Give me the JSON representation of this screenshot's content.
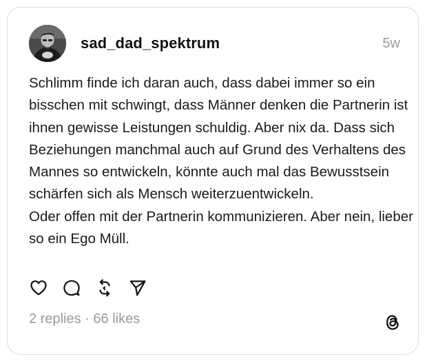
{
  "post": {
    "username": "sad_dad_spektrum",
    "timestamp": "5w",
    "paragraphs": [
      "Schlimm finde ich daran auch, dass dabei immer so ein bisschen mit schwingt, dass Männer denken die Partnerin ist ihnen gewisse Leistungen schuldig. Aber nix da. Dass sich Beziehungen manchmal auch auf Grund des Verhaltens des Mannes so entwickeln, könnte auch mal das Bewusstsein schärfen sich als Mensch weiterzuentwickeln.",
      "Oder offen mit der Partnerin kommunizieren. Aber nein, lieber so ein Ego Müll."
    ],
    "replies": "2 replies",
    "separator": " · ",
    "likes": "66 likes"
  },
  "icons": {
    "like": "heart-icon",
    "reply": "comment-bubble-icon",
    "repost": "repost-icon",
    "share": "send-icon",
    "brand": "threads-logo-icon"
  }
}
